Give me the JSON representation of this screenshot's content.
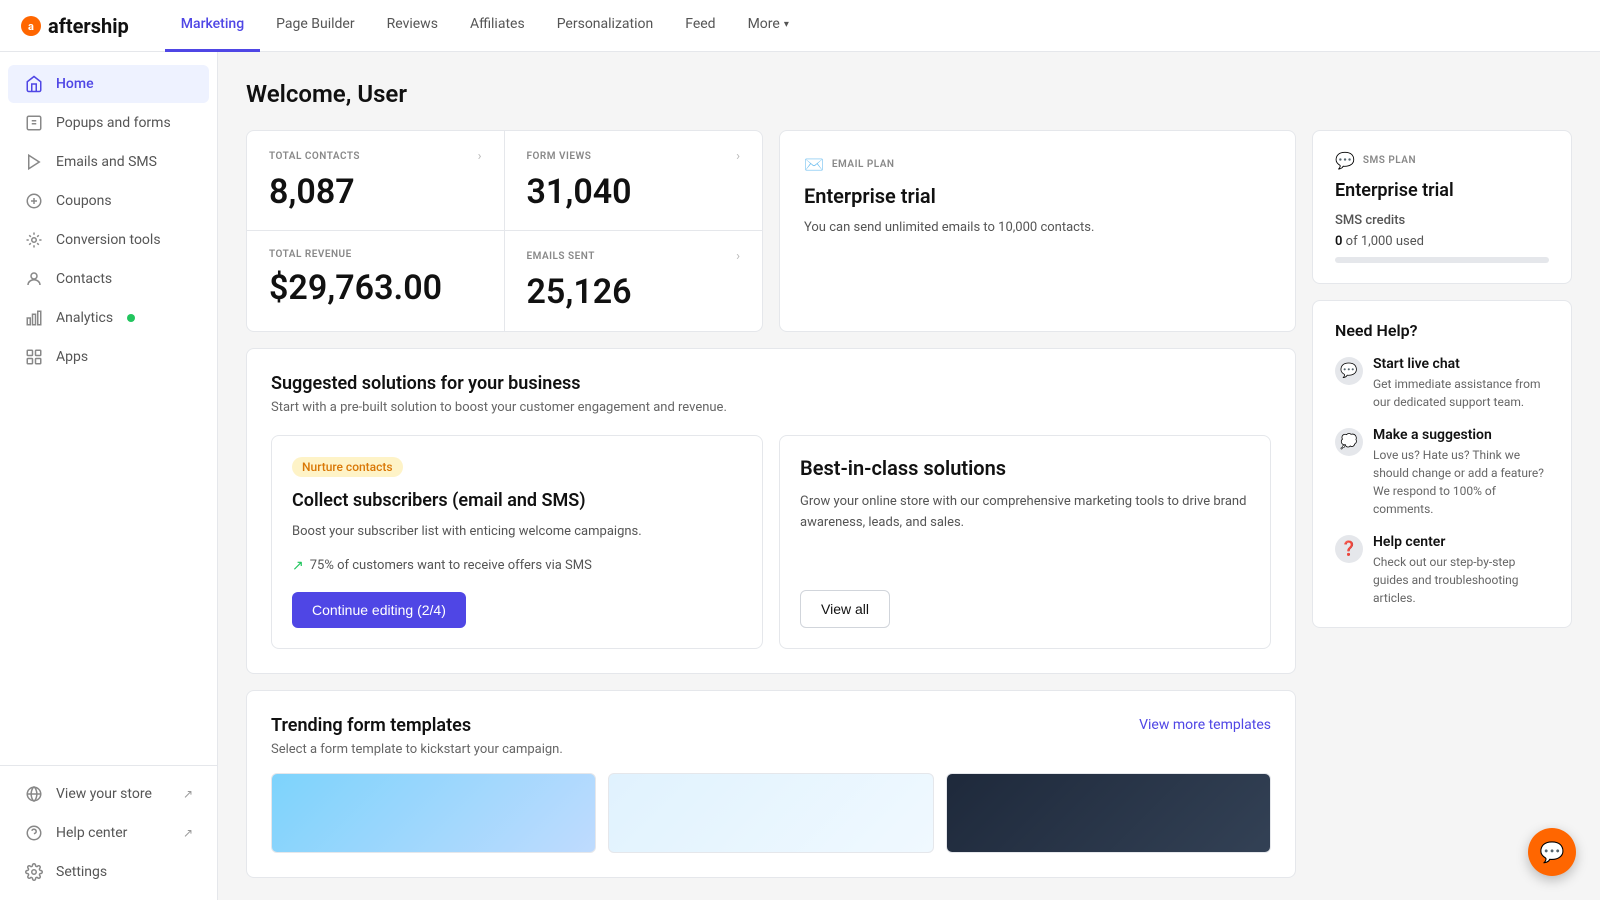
{
  "logo": {
    "text": "aftership"
  },
  "topNav": {
    "links": [
      {
        "label": "Marketing",
        "active": true
      },
      {
        "label": "Page Builder",
        "active": false
      },
      {
        "label": "Reviews",
        "active": false
      },
      {
        "label": "Affiliates",
        "active": false
      },
      {
        "label": "Personalization",
        "active": false
      },
      {
        "label": "Feed",
        "active": false
      },
      {
        "label": "More",
        "active": false,
        "hasChevron": true
      }
    ]
  },
  "sidebar": {
    "items": [
      {
        "id": "home",
        "label": "Home",
        "active": true
      },
      {
        "id": "popups-and-forms",
        "label": "Popups and forms",
        "active": false
      },
      {
        "id": "emails-and-sms",
        "label": "Emails and SMS",
        "active": false
      },
      {
        "id": "coupons",
        "label": "Coupons",
        "active": false
      },
      {
        "id": "conversion-tools",
        "label": "Conversion tools",
        "active": false
      },
      {
        "id": "contacts",
        "label": "Contacts",
        "active": false
      },
      {
        "id": "analytics",
        "label": "Analytics",
        "active": false,
        "hasNotification": true
      },
      {
        "id": "apps",
        "label": "Apps",
        "active": false
      }
    ],
    "bottomItems": [
      {
        "id": "view-your-store",
        "label": "View your store",
        "external": true
      },
      {
        "id": "help-center",
        "label": "Help center",
        "external": true
      },
      {
        "id": "settings",
        "label": "Settings",
        "external": false
      }
    ]
  },
  "pageTitle": "Welcome, User",
  "stats": {
    "totalContacts": {
      "label": "TOTAL CONTACTS",
      "value": "8,087"
    },
    "formViews": {
      "label": "FORM VIEWS",
      "value": "31,040"
    },
    "totalRevenue": {
      "label": "TOTAL REVENUE",
      "value": "$29,763.00"
    },
    "emailsSent": {
      "label": "EMAILS SENT",
      "value": "25,126"
    }
  },
  "emailPlan": {
    "planLabel": "EMAIL PLAN",
    "title": "Enterprise trial",
    "description": "You can send unlimited emails to 10,000 contacts."
  },
  "smsPlan": {
    "planLabel": "SMS PLAN",
    "title": "Enterprise trial",
    "creditsLabel": "SMS credits",
    "creditsUsed": "0",
    "creditsTotal": "1,000",
    "creditsText": "of 1,000 used",
    "progressPercent": 0
  },
  "suggestedSolutions": {
    "title": "Suggested solutions for your business",
    "subtitle": "Start with a pre-built solution to boost your customer engagement and revenue.",
    "collect": {
      "badge": "Nurture contacts",
      "title": "Collect subscribers (email and SMS)",
      "description": "Boost your subscriber list with enticing welcome campaigns.",
      "stat": "75% of customers want to receive offers via SMS",
      "buttonLabel": "Continue editing (2/4)"
    },
    "bestInClass": {
      "title": "Best-in-class solutions",
      "description": "Grow your online store with our comprehensive marketing tools to drive brand awareness, leads, and sales.",
      "buttonLabel": "View all"
    }
  },
  "trendingTemplates": {
    "title": "Trending form templates",
    "subtitle": "Select a form template to kickstart your campaign.",
    "viewMoreLabel": "View more templates"
  },
  "needHelp": {
    "title": "Need Help?",
    "items": [
      {
        "id": "live-chat",
        "title": "Start live chat",
        "description": "Get immediate assistance from our dedicated support team."
      },
      {
        "id": "make-suggestion",
        "title": "Make a suggestion",
        "description": "Love us? Hate us? Think we should change or add a feature? We respond to 100% of comments."
      },
      {
        "id": "help-center",
        "title": "Help center",
        "description": "Check out our step-by-step guides and troubleshooting articles."
      }
    ]
  },
  "colors": {
    "primary": "#4f46e5",
    "accent": "#ff6600",
    "success": "#22c55e",
    "warning": "#d97706"
  }
}
